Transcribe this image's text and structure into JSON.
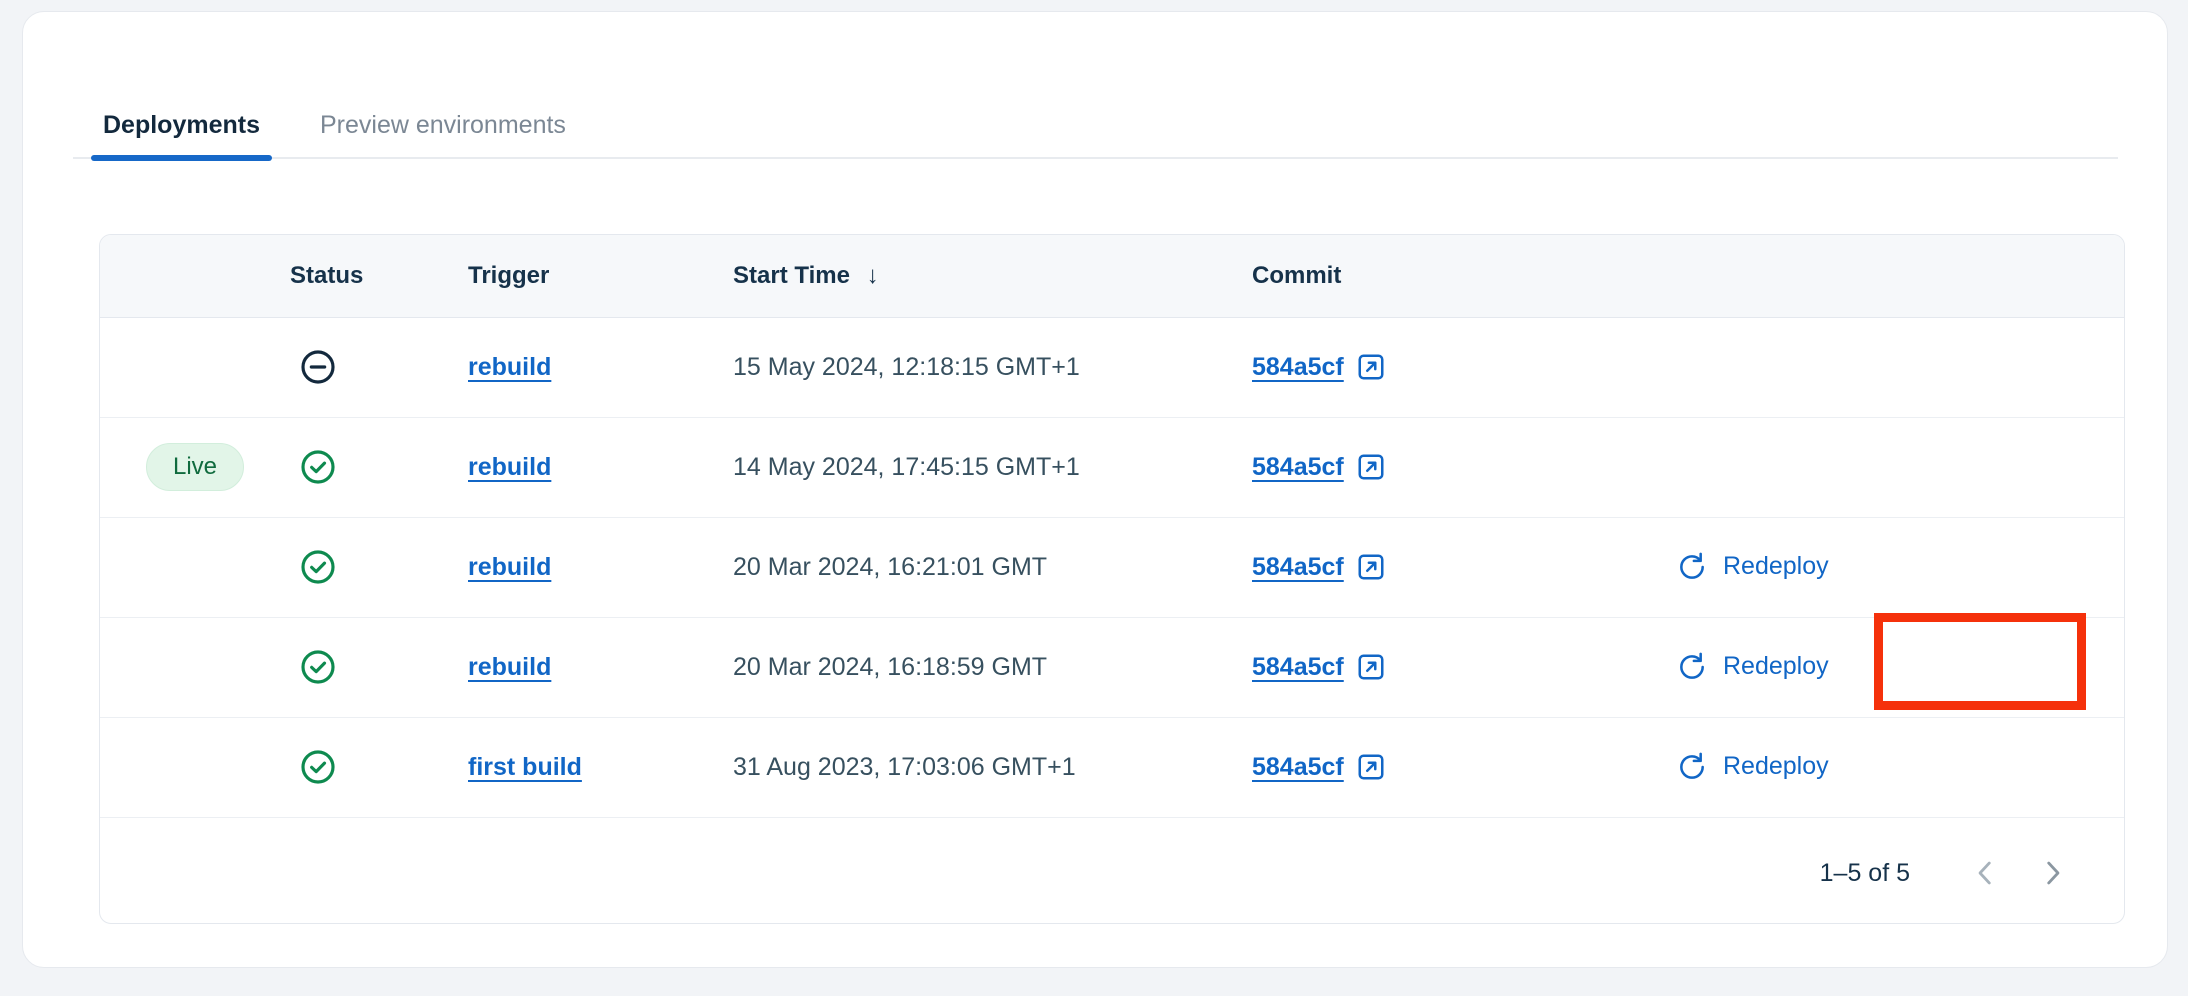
{
  "tabs": [
    {
      "label": "Deployments",
      "active": true
    },
    {
      "label": "Preview environments",
      "active": false
    }
  ],
  "table": {
    "headers": {
      "live": "",
      "status": "Status",
      "trigger": "Trigger",
      "start_time": "Start Time",
      "sort_indicator": "↓",
      "commit": "Commit",
      "action": ""
    },
    "rows": [
      {
        "live_badge": "",
        "status_icon": "circle-minus-icon",
        "trigger": "rebuild",
        "start_time": "15 May 2024, 12:18:15 GMT+1",
        "commit": "584a5cf",
        "action": ""
      },
      {
        "live_badge": "Live",
        "status_icon": "circle-check-icon",
        "trigger": "rebuild",
        "start_time": "14 May 2024, 17:45:15 GMT+1",
        "commit": "584a5cf",
        "action": ""
      },
      {
        "live_badge": "",
        "status_icon": "circle-check-icon",
        "trigger": "rebuild",
        "start_time": "20 Mar 2024, 16:21:01 GMT",
        "commit": "584a5cf",
        "action": "Redeploy"
      },
      {
        "live_badge": "",
        "status_icon": "circle-check-icon",
        "trigger": "rebuild",
        "start_time": "20 Mar 2024, 16:18:59 GMT",
        "commit": "584a5cf",
        "action": "Redeploy"
      },
      {
        "live_badge": "",
        "status_icon": "circle-check-icon",
        "trigger": "first build",
        "start_time": "31 Aug 2023, 17:03:06 GMT+1",
        "commit": "584a5cf",
        "action": "Redeploy"
      }
    ]
  },
  "footer": {
    "page_count": "1–5 of 5",
    "prev_icon": "chevron-left-icon",
    "next_icon": "chevron-right-icon"
  },
  "colors": {
    "accent_blue": "#1166c6",
    "tab_underline": "#1668c8",
    "success_green": "#0e8a4f",
    "live_badge_bg": "#e2f5e8",
    "live_badge_text": "#106b3e",
    "neutral_dark": "#13293d",
    "annotation_red": "#f5310b"
  }
}
